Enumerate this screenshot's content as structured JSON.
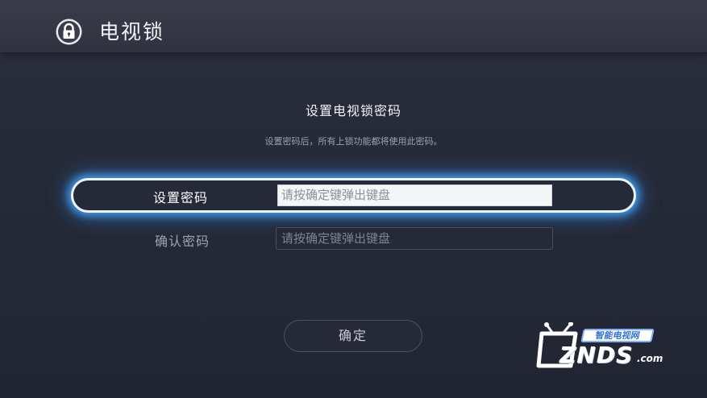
{
  "header": {
    "icon": "lock-icon",
    "title": "电视锁"
  },
  "main": {
    "heading": "设置电视锁密码",
    "subtitle": "设置密码后，所有上锁功能都将使用此密码。",
    "fields": [
      {
        "label": "设置密码",
        "placeholder": "请按确定键弹出键盘",
        "focused": true
      },
      {
        "label": "确认密码",
        "placeholder": "请按确定键弹出键盘",
        "focused": false
      }
    ],
    "confirm_button": "确定"
  },
  "watermark": {
    "subtitle": "智能电视网",
    "brand": "ZNDS",
    "domain": ".com",
    "icon": "tv-icon"
  },
  "colors": {
    "focus_glow": "#46aaff",
    "background": "#262a37"
  }
}
